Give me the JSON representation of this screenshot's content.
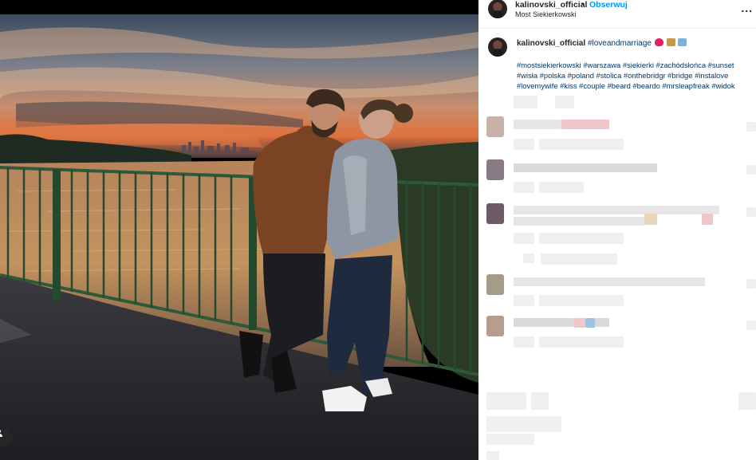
{
  "post": {
    "username": "kalinovski_official",
    "separator": "•",
    "follow_label": "Obserwuj",
    "location": "Most Siekierkowski",
    "more_label": "...",
    "caption_hashtag_first": "#loveandmarriage",
    "caption_tags": "#mostsiekierkowski #warszawa #siekierki #zachódsłońca #sunset #wisła #polska #poland #stolica #onthebridgr #bridge #instalove #lovemywife #kiss #couple #beard #beardo #mrsleapfreak #widok"
  },
  "icons": {
    "tag": "person-tag-icon",
    "more": "more-options-icon",
    "heart": "heart-emoji-icon",
    "couple": "couple-emoji-icon",
    "map": "map-emoji-icon"
  },
  "colors": {
    "link": "#0095f6",
    "hashtag": "#00376b",
    "text": "#262626",
    "heart": "#e0245e"
  }
}
